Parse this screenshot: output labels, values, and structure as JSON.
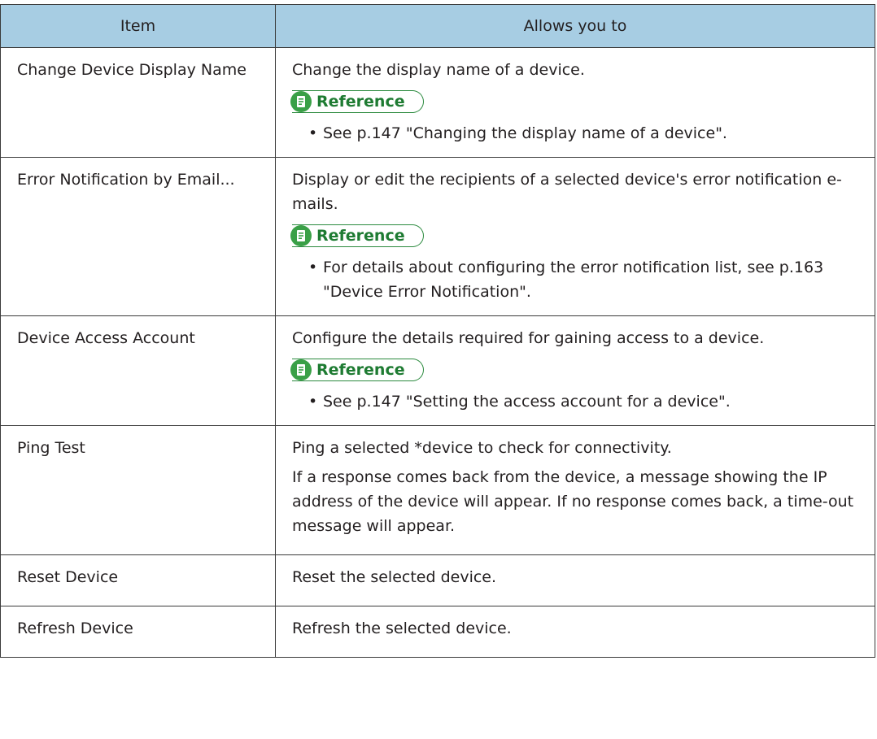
{
  "table": {
    "header": {
      "item": "Item",
      "allows": "Allows you to"
    },
    "reference_label": "Reference",
    "rows": [
      {
        "item": "Change Device Display Name",
        "paragraphs": [
          "Change the display name of a device."
        ],
        "reference": [
          "See p.147 \"Changing the display name of a device\"."
        ]
      },
      {
        "item": "Error Notification by Email...",
        "paragraphs": [
          "Display or edit the recipients of a selected device's error notification e-mails."
        ],
        "reference": [
          "For details about configuring the error notification list, see p.163 \"Device Error Notification\"."
        ]
      },
      {
        "item": "Device Access Account",
        "paragraphs": [
          "Configure the details required for gaining access to a device."
        ],
        "reference": [
          "See p.147 \"Setting the access account for a device\"."
        ]
      },
      {
        "item": "Ping Test",
        "paragraphs": [
          "Ping a selected *device to check for connectivity.",
          "If a response comes back from the device, a message showing the IP address of the device will appear. If no response comes back, a time-out message will appear."
        ],
        "reference": []
      },
      {
        "item": "Reset Device",
        "paragraphs": [
          "Reset the selected device."
        ],
        "reference": []
      },
      {
        "item": "Refresh Device",
        "paragraphs": [
          "Refresh the selected device."
        ],
        "reference": []
      }
    ]
  },
  "colors": {
    "header_bg": "#a7cde3",
    "reference_green": "#3aa047"
  },
  "icons": {
    "reference": "reference-document-icon"
  }
}
